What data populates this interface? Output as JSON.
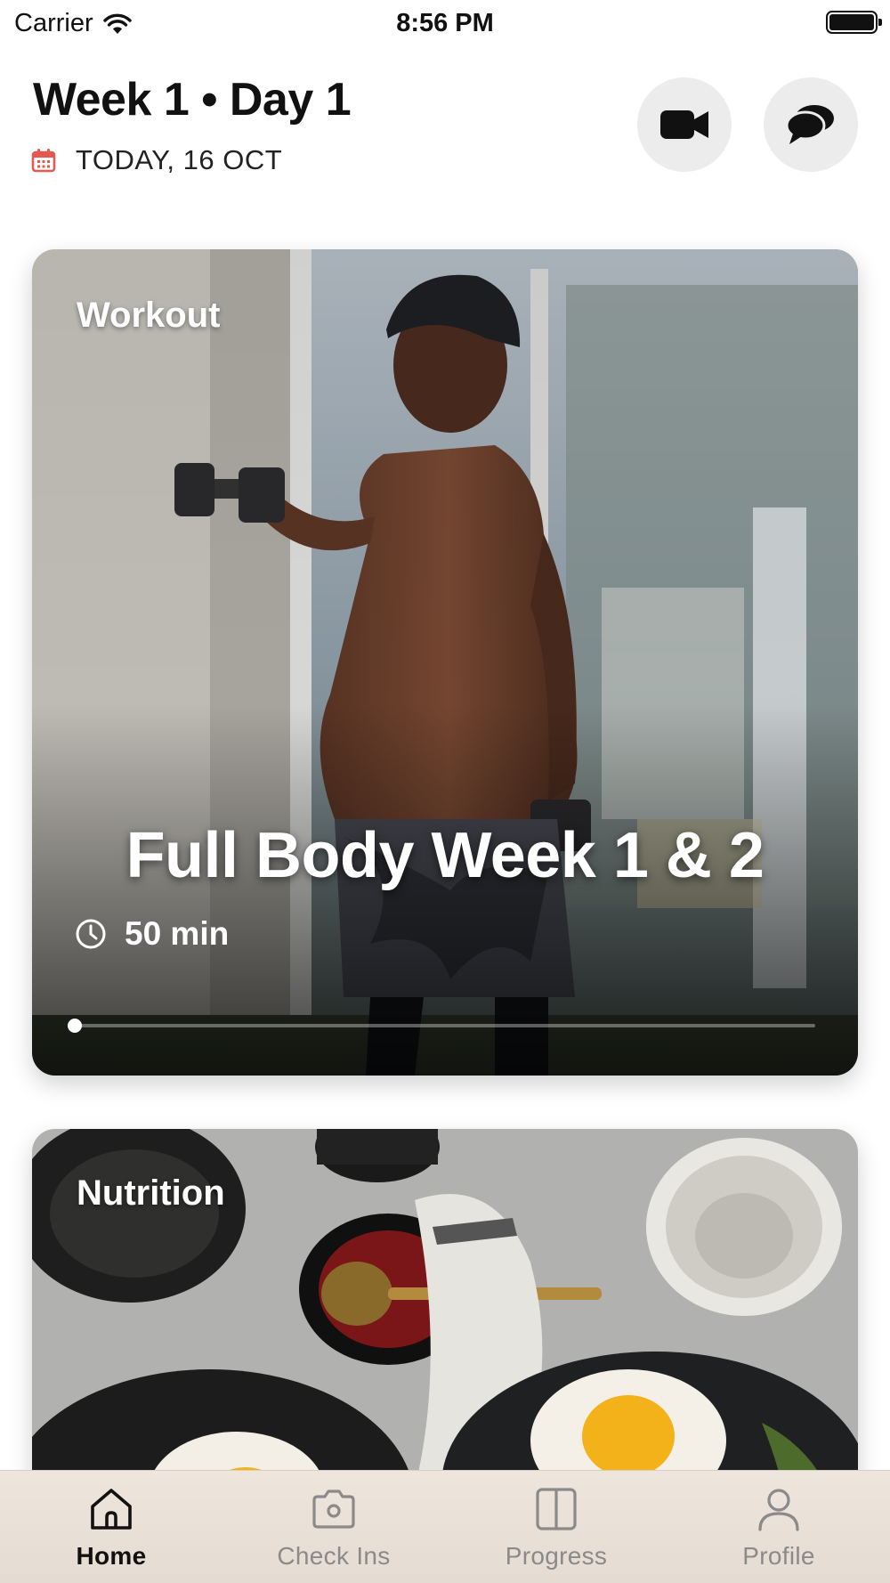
{
  "status_bar": {
    "carrier": "Carrier",
    "time": "8:56 PM",
    "wifi_icon": "wifi-icon",
    "battery_icon": "battery-icon"
  },
  "header": {
    "title": "Week 1 • Day 1",
    "date": "TODAY, 16 OCT",
    "date_icon": "calendar-icon",
    "accent_color": "#e25a4f",
    "actions": [
      {
        "name": "video-call-button",
        "icon": "video-camera-icon"
      },
      {
        "name": "chat-button",
        "icon": "chat-bubbles-icon"
      }
    ]
  },
  "workout_card": {
    "label": "Workout",
    "title": "Full Body Week 1 & 2",
    "duration": "50 min",
    "duration_icon": "clock-icon",
    "progress": 0.0
  },
  "nutrition_card": {
    "label": "Nutrition"
  },
  "tab_bar": {
    "items": [
      {
        "label": "Home",
        "icon": "home-icon",
        "active": true
      },
      {
        "label": "Check Ins",
        "icon": "camera-icon",
        "active": false
      },
      {
        "label": "Progress",
        "icon": "split-panel-icon",
        "active": false
      },
      {
        "label": "Profile",
        "icon": "person-icon",
        "active": false
      }
    ],
    "active_color": "#111111",
    "inactive_color": "#8a8a8a"
  }
}
